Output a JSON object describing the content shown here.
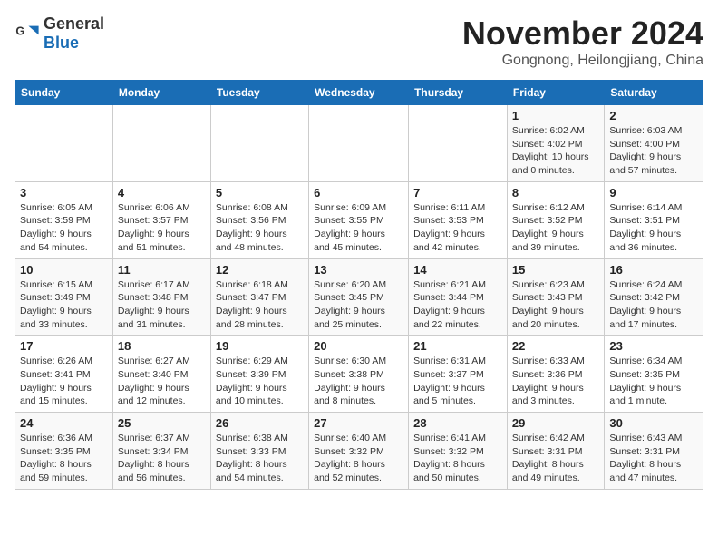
{
  "header": {
    "logo_general": "General",
    "logo_blue": "Blue",
    "title": "November 2024",
    "subtitle": "Gongnong, Heilongjiang, China"
  },
  "weekdays": [
    "Sunday",
    "Monday",
    "Tuesday",
    "Wednesday",
    "Thursday",
    "Friday",
    "Saturday"
  ],
  "weeks": [
    [
      {
        "day": "",
        "info": ""
      },
      {
        "day": "",
        "info": ""
      },
      {
        "day": "",
        "info": ""
      },
      {
        "day": "",
        "info": ""
      },
      {
        "day": "",
        "info": ""
      },
      {
        "day": "1",
        "info": "Sunrise: 6:02 AM\nSunset: 4:02 PM\nDaylight: 10 hours and 0 minutes."
      },
      {
        "day": "2",
        "info": "Sunrise: 6:03 AM\nSunset: 4:00 PM\nDaylight: 9 hours and 57 minutes."
      }
    ],
    [
      {
        "day": "3",
        "info": "Sunrise: 6:05 AM\nSunset: 3:59 PM\nDaylight: 9 hours and 54 minutes."
      },
      {
        "day": "4",
        "info": "Sunrise: 6:06 AM\nSunset: 3:57 PM\nDaylight: 9 hours and 51 minutes."
      },
      {
        "day": "5",
        "info": "Sunrise: 6:08 AM\nSunset: 3:56 PM\nDaylight: 9 hours and 48 minutes."
      },
      {
        "day": "6",
        "info": "Sunrise: 6:09 AM\nSunset: 3:55 PM\nDaylight: 9 hours and 45 minutes."
      },
      {
        "day": "7",
        "info": "Sunrise: 6:11 AM\nSunset: 3:53 PM\nDaylight: 9 hours and 42 minutes."
      },
      {
        "day": "8",
        "info": "Sunrise: 6:12 AM\nSunset: 3:52 PM\nDaylight: 9 hours and 39 minutes."
      },
      {
        "day": "9",
        "info": "Sunrise: 6:14 AM\nSunset: 3:51 PM\nDaylight: 9 hours and 36 minutes."
      }
    ],
    [
      {
        "day": "10",
        "info": "Sunrise: 6:15 AM\nSunset: 3:49 PM\nDaylight: 9 hours and 33 minutes."
      },
      {
        "day": "11",
        "info": "Sunrise: 6:17 AM\nSunset: 3:48 PM\nDaylight: 9 hours and 31 minutes."
      },
      {
        "day": "12",
        "info": "Sunrise: 6:18 AM\nSunset: 3:47 PM\nDaylight: 9 hours and 28 minutes."
      },
      {
        "day": "13",
        "info": "Sunrise: 6:20 AM\nSunset: 3:45 PM\nDaylight: 9 hours and 25 minutes."
      },
      {
        "day": "14",
        "info": "Sunrise: 6:21 AM\nSunset: 3:44 PM\nDaylight: 9 hours and 22 minutes."
      },
      {
        "day": "15",
        "info": "Sunrise: 6:23 AM\nSunset: 3:43 PM\nDaylight: 9 hours and 20 minutes."
      },
      {
        "day": "16",
        "info": "Sunrise: 6:24 AM\nSunset: 3:42 PM\nDaylight: 9 hours and 17 minutes."
      }
    ],
    [
      {
        "day": "17",
        "info": "Sunrise: 6:26 AM\nSunset: 3:41 PM\nDaylight: 9 hours and 15 minutes."
      },
      {
        "day": "18",
        "info": "Sunrise: 6:27 AM\nSunset: 3:40 PM\nDaylight: 9 hours and 12 minutes."
      },
      {
        "day": "19",
        "info": "Sunrise: 6:29 AM\nSunset: 3:39 PM\nDaylight: 9 hours and 10 minutes."
      },
      {
        "day": "20",
        "info": "Sunrise: 6:30 AM\nSunset: 3:38 PM\nDaylight: 9 hours and 8 minutes."
      },
      {
        "day": "21",
        "info": "Sunrise: 6:31 AM\nSunset: 3:37 PM\nDaylight: 9 hours and 5 minutes."
      },
      {
        "day": "22",
        "info": "Sunrise: 6:33 AM\nSunset: 3:36 PM\nDaylight: 9 hours and 3 minutes."
      },
      {
        "day": "23",
        "info": "Sunrise: 6:34 AM\nSunset: 3:35 PM\nDaylight: 9 hours and 1 minute."
      }
    ],
    [
      {
        "day": "24",
        "info": "Sunrise: 6:36 AM\nSunset: 3:35 PM\nDaylight: 8 hours and 59 minutes."
      },
      {
        "day": "25",
        "info": "Sunrise: 6:37 AM\nSunset: 3:34 PM\nDaylight: 8 hours and 56 minutes."
      },
      {
        "day": "26",
        "info": "Sunrise: 6:38 AM\nSunset: 3:33 PM\nDaylight: 8 hours and 54 minutes."
      },
      {
        "day": "27",
        "info": "Sunrise: 6:40 AM\nSunset: 3:32 PM\nDaylight: 8 hours and 52 minutes."
      },
      {
        "day": "28",
        "info": "Sunrise: 6:41 AM\nSunset: 3:32 PM\nDaylight: 8 hours and 50 minutes."
      },
      {
        "day": "29",
        "info": "Sunrise: 6:42 AM\nSunset: 3:31 PM\nDaylight: 8 hours and 49 minutes."
      },
      {
        "day": "30",
        "info": "Sunrise: 6:43 AM\nSunset: 3:31 PM\nDaylight: 8 hours and 47 minutes."
      }
    ]
  ]
}
